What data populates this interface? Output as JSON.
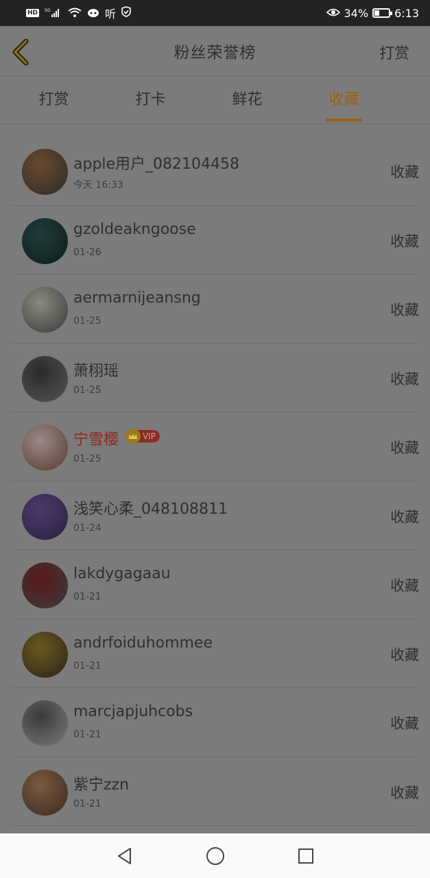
{
  "status_bar": {
    "hd": "HD",
    "network": "5G",
    "listen_icon_text": "听",
    "battery_percent": "34%",
    "battery_level": 0.34,
    "time": "6:13"
  },
  "header": {
    "title": "粉丝荣誉榜",
    "action": "打赏"
  },
  "tabs": [
    {
      "label": "打赏",
      "active": false
    },
    {
      "label": "打卡",
      "active": false
    },
    {
      "label": "鲜花",
      "active": false
    },
    {
      "label": "收藏",
      "active": true
    }
  ],
  "list": [
    {
      "name": "apple用户_082104458",
      "time": "今天  16:33",
      "action": "收藏",
      "avatar_colors": [
        "#6a4a2e",
        "#2a2a2a"
      ]
    },
    {
      "name": "gzoldeakngoose",
      "time": "01-26",
      "action": "收藏",
      "avatar_colors": [
        "#1f3d3a",
        "#0f1c1c"
      ]
    },
    {
      "name": "aermarnijeansng",
      "time": "01-25",
      "action": "收藏",
      "avatar_colors": [
        "#8a8a80",
        "#3a3a38"
      ]
    },
    {
      "name": "萧栩瑶",
      "time": "01-25",
      "action": "收藏",
      "avatar_colors": [
        "#2a2a2a",
        "#555555"
      ]
    },
    {
      "name": "宁雪樱",
      "time": "01-25",
      "action": "收藏",
      "vip": true,
      "vip_label": "VIP",
      "avatar_colors": [
        "#9a8a88",
        "#5a3a30"
      ]
    },
    {
      "name": "浅笑心柔_048108811",
      "time": "01-24",
      "action": "收藏",
      "avatar_colors": [
        "#4a3a6a",
        "#2a2040"
      ]
    },
    {
      "name": "lakdygagaau",
      "time": "01-21",
      "action": "收藏",
      "avatar_colors": [
        "#5a1a1a",
        "#3a3a3a"
      ]
    },
    {
      "name": "andrfoiduhommee",
      "time": "01-21",
      "action": "收藏",
      "avatar_colors": [
        "#6a5a20",
        "#2a2218"
      ]
    },
    {
      "name": "marcjapjuhcobs",
      "time": "01-21",
      "action": "收藏",
      "avatar_colors": [
        "#3a3a3a",
        "#7a7a7a"
      ]
    },
    {
      "name": "紫宁zzn",
      "time": "01-21",
      "action": "收藏",
      "avatar_colors": [
        "#7a5a40",
        "#3a2a20"
      ]
    }
  ]
}
